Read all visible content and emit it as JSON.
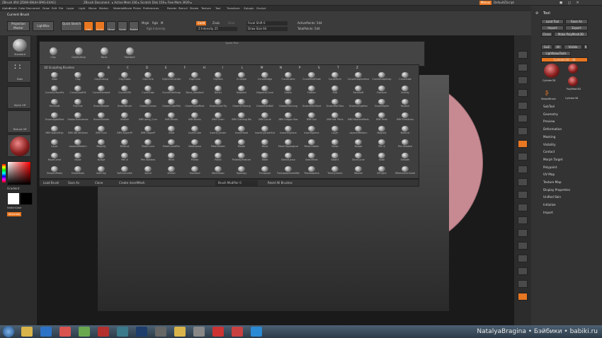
{
  "titlebar": {
    "app_title": "ZBrush 4R4 [ZD89-ENUH-SPKS-EXAG]",
    "doc_label": "ZBrush Document",
    "active_mem": "▸ Active Mem 336 ▸ Scratch Disk 159 ▸ Free Mem 3929 ▸",
    "menus_btn": "Menus",
    "script_label": "DefaultZScript"
  },
  "menubar": {
    "items": [
      "Alpha",
      "Brush",
      "Color",
      "Document",
      "Draw",
      "Edit",
      "File",
      "Layer",
      "Light",
      "Macro",
      "Marker",
      "Material",
      "Movie",
      "Picker",
      "Preferences",
      "Render",
      "Stencil",
      "Stroke",
      "Texture",
      "Tool",
      "Transform",
      "Zplugin",
      "Zscript"
    ]
  },
  "toolbar": {
    "current_brush": "Current Brush",
    "projection_master": "Projection Master",
    "lightbox": "LightBox",
    "quick_sketch": "Quick Sketch",
    "edit": "Edit",
    "draw": "Draw",
    "move": "Move",
    "scale": "Scale",
    "rotate": "Rotate",
    "mrgb": "Mrgb",
    "rgb": "Rgb",
    "m": "M",
    "zadd": "Zadd",
    "zsub": "Zsub",
    "zcut": "Zcut",
    "rgb_intensity": "Rgb Intensity",
    "z_intensity": "Z Intensity 25",
    "focal_shift": "Focal Shift 0",
    "draw_size": "Draw Size 64",
    "active_points": "ActivePoints: 544",
    "total_points": "TotalPoints: 544"
  },
  "left_shelf": {
    "brush_label": "Standard",
    "stroke_label": "Dots",
    "alpha_label": "Alpha Off",
    "texture_label": "Texture Off",
    "material_label": "MatCap Red",
    "gradient": "Gradient",
    "switch_color": "SwitchColor",
    "alternate": "Alternate"
  },
  "quick_pick": {
    "title": "Quick Pick",
    "items": [
      "Clay",
      "ClayBuildup",
      "Move",
      "Standard"
    ]
  },
  "brush_panel": {
    "title": "3D Sculpting Brushes",
    "shortcut_letters": [
      "B",
      "C",
      "D",
      "E",
      "F",
      "H",
      "I",
      "L",
      "M",
      "N",
      "P",
      "S",
      "T",
      "Z"
    ],
    "brushes": [
      [
        "Blob",
        "Clay",
        "ClayBuildup",
        "ClayTubes",
        "ClipCircle",
        "ClipCircleCenter",
        "ClipCurve",
        "ClipRect",
        "Crumple",
        "CurveBridge",
        "CurveLathe",
        "CurveMultiTube",
        "CurvePinch",
        "CurveSnapSurface",
        "CurveStrapSnap",
        "CurveTube"
      ],
      [
        "CurveSurfaceFix",
        "CurveQuadFill",
        "CurveStandard",
        "CurveTriFill",
        "CurveTube",
        "CurveTubeSnap",
        "Deco_Standard",
        "Deco1",
        "Displace",
        "DisplaceCurve",
        "Elastic",
        "Flatten",
        "Fold",
        "FormSoft",
        "Fracture",
        "Gravity"
      ],
      [
        "FormSoft",
        "FracHue",
        "GroomBlower",
        "GroomBrush",
        "GroomClumps",
        "GroomColorMid",
        "GroomColorRoot",
        "GroomColorTip",
        "GroomerStrong",
        "GroomHairBall",
        "GroomHairLong",
        "GroomHairShort",
        "GroomHairToss",
        "GroomLengthen",
        "GroomSpike",
        "Hpolish"
      ],
      [
        "GroomSpikeFast",
        "GroomTurbulence",
        "GroomTwister",
        "hPolish",
        "IMM Army_Curv",
        "IMM BParts",
        "IMM Bricks",
        "IMM Chain",
        "IMM Clothing Ma",
        "IMM Curve",
        "IMM Dragon Box",
        "IMM Gun",
        "IMM Ind. Parts",
        "IMM MachineParts",
        "IMM Parts",
        "IMM Primitives"
      ],
      [
        "IMM SpaceShip",
        "IMM ZBrushSean",
        "IMM Train",
        "IMM ZipperM",
        "IMM ZipperP",
        "Inflat",
        "InsertCube",
        "InsertCylinder",
        "InsertHead",
        "InsertCylinderExt",
        "InsertHSphere",
        "InsertSphere",
        "Layer",
        "LayeredPattern",
        "Magnify",
        "MAHcut"
      ],
      [
        "Layer",
        "LayeredPattern",
        "Magnify",
        "MAHcut",
        "MaskCurve",
        "MaskCurvePen",
        "MaskLasso",
        "MatchMaker",
        "Morph",
        "Move",
        "Move Topological",
        "Move Elastic",
        "Noise",
        "Nudge",
        "Pen A",
        "Pen Shadow"
      ],
      [
        "MoveCurve",
        "Noise",
        "Nudge",
        "Pen A",
        "Pen Shadow",
        "Pinch",
        "Planar",
        "Polish",
        "PolishByFeature",
        "Rake",
        "SelectLasso",
        "SelectRect",
        "Slash3",
        "SliceCurve",
        "Slide",
        "Smooth"
      ],
      [
        "SmoothPeaks",
        "SnakeHook",
        "SoftClay",
        "SoftConcrete",
        "Spiral",
        "sPolish",
        "Standard",
        "StitchBasic",
        "Topology",
        "Transpose",
        "TransposeSmartMask",
        "TrimAdaptive",
        "TrimDynamic",
        "Weavel",
        "ZProject",
        "ZRemesherGuide"
      ]
    ]
  },
  "brush_footer": {
    "load_brush": "Load Brush",
    "save_as": "Save As",
    "clone": "Clone",
    "create_insert": "Create InsertMesh",
    "brush_modifier": "Brush Modifier 0",
    "reset_all": "Reset All Brushes"
  },
  "tray": {
    "title": "Tool",
    "load_tool": "Load Tool",
    "save_as": "Save As",
    "import": "Import",
    "export": "Export",
    "clone": "Clone",
    "make_polymesh": "Make PolyMesh3D",
    "goz": "GoZ",
    "all": "All",
    "visible": "Visible",
    "r": "R",
    "lightbox_tools": "Lightbox▸Tools",
    "current_tool": "Cylinder3D . 48",
    "tools": [
      "Cylinder3D",
      "PolyMesh3D",
      "SimpleBrush",
      "Cylinder3D"
    ],
    "sections": [
      "SubTool",
      "Geometry",
      "Preview",
      "Deformation",
      "Masking",
      "Visibility",
      "Contact",
      "Morph Target",
      "Polypaint",
      "UV Map",
      "Texture Map",
      "Display Properties",
      "Unified Skin",
      "Initialize",
      "Import"
    ]
  },
  "right_shelf": {
    "items": [
      "Bpr",
      "Spix",
      "Scroll",
      "Zoom",
      "Actual",
      "AAHalf",
      "Persp",
      "Floor",
      "Local",
      "L.Sym",
      "Xyz",
      "Frame",
      "Move",
      "Scale",
      "Rotate",
      "PolyF",
      "Transp",
      "Ghost",
      "Solo",
      "Xpose"
    ]
  },
  "taskbar": {
    "watermark": "NatalyaBragina • Бэйбики • babiki.ru"
  },
  "colors": {
    "accent": "#e87722",
    "sphere": "#c88a92",
    "panel": "#3f3f3f"
  }
}
